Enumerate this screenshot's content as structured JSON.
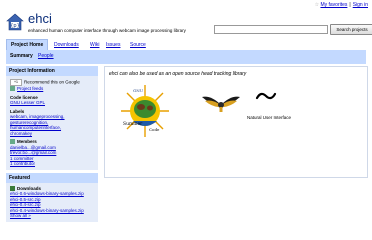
{
  "top_links": {
    "favorites": "My favorites",
    "signin": "Sign in"
  },
  "header": {
    "project_name": "ehci",
    "summary": "enhanced human computer interface through webcam image processing library",
    "search_button": "Search projects"
  },
  "tabs": [
    {
      "label": "Project Home",
      "active": true
    },
    {
      "label": "Downloads"
    },
    {
      "label": "Wiki"
    },
    {
      "label": "Issues"
    },
    {
      "label": "Source"
    }
  ],
  "subtabs": {
    "label": "Summary",
    "link": "People"
  },
  "sidebar": {
    "info_heading": "Project Information",
    "plus_count": "+1",
    "recommend": "Recommend this on Google",
    "project_feeds": "Project feeds",
    "code_license_label": "Code license",
    "code_license": "GNU Lesser GPL",
    "labels_label": "Labels",
    "labels": [
      "webcam, imageprocessing,",
      "gesturerecognition,",
      "humancomputerinterface,",
      "chromakey"
    ],
    "members_label": "Members",
    "members": [
      "danielba...@gmail.com",
      "trevor.bo...@gmail.com"
    ],
    "committer": "1 committer",
    "contributor": "1 contributor",
    "featured_heading": "Featured",
    "downloads_label": "Downloads",
    "downloads": [
      "ehci-0.6-windows-binary-samples.zip",
      "ehci-0.5-src.zip",
      "ehci-0.4-src.zip",
      "ehci-0.4-windows-binary-samples.zip"
    ],
    "show_all": "Show all »"
  },
  "main": {
    "tagline": "ehci can also be used as an open source head tracking library",
    "nui_label": "Natural User Interface"
  },
  "colors": {
    "tab_bg": "#c3d9ff",
    "sidebar_bg": "#e5ecf9",
    "link": "#0000cc",
    "title": "#0a2d7a"
  }
}
